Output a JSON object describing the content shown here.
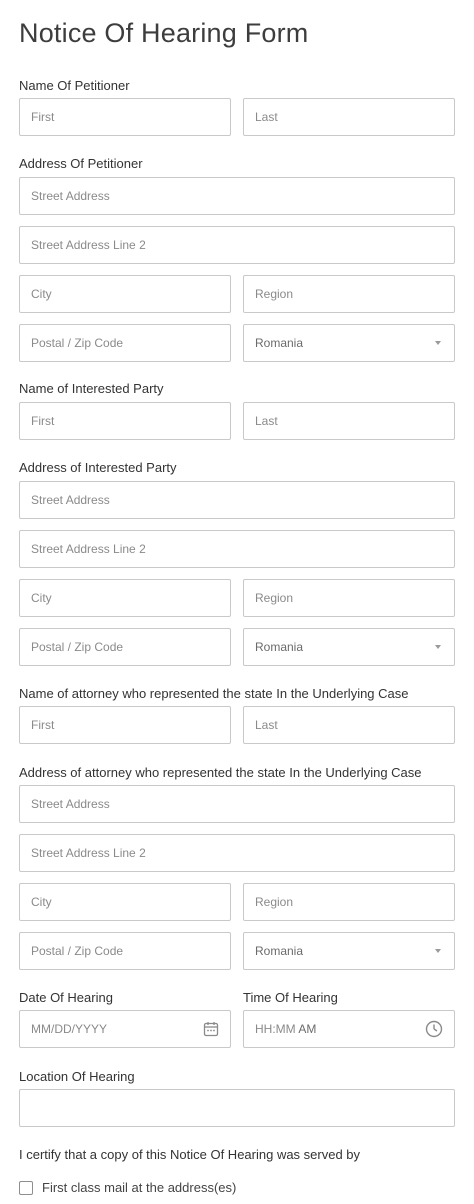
{
  "form_title": "Notice Of Hearing Form",
  "petitioner_name": {
    "label": "Name Of Petitioner",
    "first": "First",
    "last": "Last"
  },
  "petitioner_address": {
    "label": "Address Of Petitioner",
    "street": "Street Address",
    "street2": "Street Address Line 2",
    "city": "City",
    "region": "Region",
    "postal": "Postal / Zip Code",
    "country": "Romania"
  },
  "interested_name": {
    "label": "Name of Interested Party",
    "first": "First",
    "last": "Last"
  },
  "interested_address": {
    "label": "Address of Interested Party",
    "street": "Street Address",
    "street2": "Street Address Line 2",
    "city": "City",
    "region": "Region",
    "postal": "Postal / Zip Code",
    "country": "Romania"
  },
  "attorney_name": {
    "label": "Name of attorney who represented the state In the Underlying Case",
    "first": "First",
    "last": "Last"
  },
  "attorney_address": {
    "label": "Address of attorney who represented the state In the Underlying Case",
    "street": "Street Address",
    "street2": "Street Address Line 2",
    "city": "City",
    "region": "Region",
    "postal": "Postal / Zip Code",
    "country": "Romania"
  },
  "hearing_date": {
    "label": "Date Of Hearing",
    "placeholder": "MM/DD/YYYY",
    "icon": "calendar-icon"
  },
  "hearing_time": {
    "label": "Time Of Hearing",
    "placeholder": "HH:MM",
    "ampm": "AM",
    "icon": "clock-icon"
  },
  "hearing_location": {
    "label": "Location Of Hearing",
    "value": ""
  },
  "certify": {
    "label": "I certify that a copy of this Notice Of Hearing was served by",
    "option1": "First class mail at the address(es)"
  }
}
